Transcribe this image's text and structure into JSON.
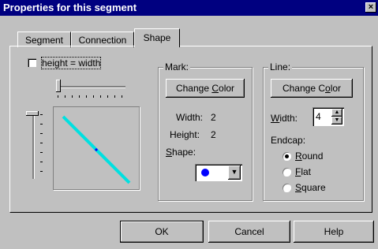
{
  "dialog": {
    "title": "Properties for this segment",
    "close_glyph": "×"
  },
  "tabs": [
    {
      "label": "Segment",
      "selected": false
    },
    {
      "label": "Connection",
      "selected": false
    },
    {
      "label": "Shape",
      "selected": true
    }
  ],
  "shape": {
    "height_eq_width_label": "height = width",
    "height_eq_width_checked": false
  },
  "mark": {
    "title": "Mark:",
    "change_color_label_pre": "Change ",
    "change_color_label_u": "C",
    "change_color_label_post": "olor",
    "width_label": "Width:",
    "width_value": "2",
    "height_label": "Height:",
    "height_value": "2",
    "shape_label_u": "S",
    "shape_label_post": "hape:",
    "shape_swatch_color": "#0000ff"
  },
  "line": {
    "title": "Line:",
    "change_color_label_pre": "Change C",
    "change_color_label_u": "o",
    "change_color_label_post": "lor",
    "width_label_u": "W",
    "width_label_post": "idth:",
    "width_value": "4",
    "endcap_label": "Endcap:",
    "endcaps": [
      {
        "label_u": "R",
        "label_post": "ound",
        "selected": true
      },
      {
        "label_u": "F",
        "label_post": "lat",
        "selected": false
      },
      {
        "label_u": "S",
        "label_post": "quare",
        "selected": false
      }
    ]
  },
  "preview": {
    "line_color": "#00e0e0",
    "dot_color": "#0000ff"
  },
  "buttons": {
    "ok": "OK",
    "cancel": "Cancel",
    "help": "Help"
  }
}
